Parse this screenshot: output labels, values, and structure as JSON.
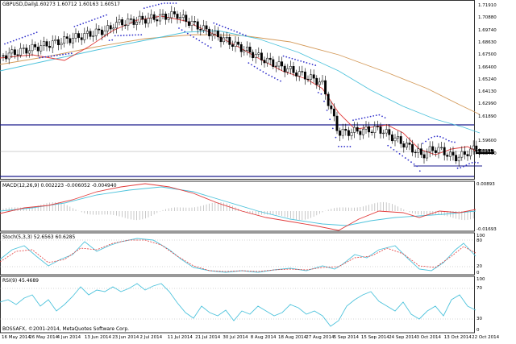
{
  "header": {
    "symbol": "GBPUSD,Daily",
    "ohlc": "1.60273 1.60712 1.60163 1.60517"
  },
  "price_axis": [
    "1.71910",
    "1.70880",
    "1.69740",
    "1.68630",
    "1.67500",
    "1.66400",
    "1.65240",
    "1.64130",
    "1.62990",
    "1.61890",
    "1.60517",
    "1.59600",
    "1.58490"
  ],
  "current_price": "1.60517",
  "macd": {
    "label": "MACD(12,26,9) 0.002223 -0.006052 -0.004940",
    "axis_top": "0.00893",
    "axis_bottom": "-0.01693"
  },
  "stoch": {
    "label": "Stoch(5,3,3) 52.6563 60.6285",
    "axis": [
      "100",
      "80",
      "20",
      "0"
    ]
  },
  "rsi": {
    "label": "RSI(9) 45.4689",
    "axis": [
      "100",
      "70",
      "30",
      "0"
    ]
  },
  "copyright": "BOSSAFX, ©2001-2014, MetaQuotes Software Corp.",
  "dates": [
    "16 May 2014",
    "26 May 2014",
    "4 Jun 2014",
    "13 Jun 2014",
    "23 Jun 2014",
    "2 Jul 2014",
    "11 Jul 2014",
    "21 Jul 2014",
    "30 Jul 2014",
    "8 Aug 2014",
    "18 Aug 2014",
    "27 Aug 2014",
    "5 Sep 2014",
    "15 Sep 2014",
    "24 Sep 2014",
    "3 Oct 2014",
    "13 Oct 2014",
    "22 Oct 2014"
  ],
  "colors": {
    "sma_fast": "#e23c3c",
    "sma_mid": "#4ec3dc",
    "sma_slow": "#d49a5a",
    "sar": "#3333cc",
    "hline": "#1a1a8c",
    "macd_signal": "#4ec3dc",
    "macd_main": "#e23c3c"
  }
}
